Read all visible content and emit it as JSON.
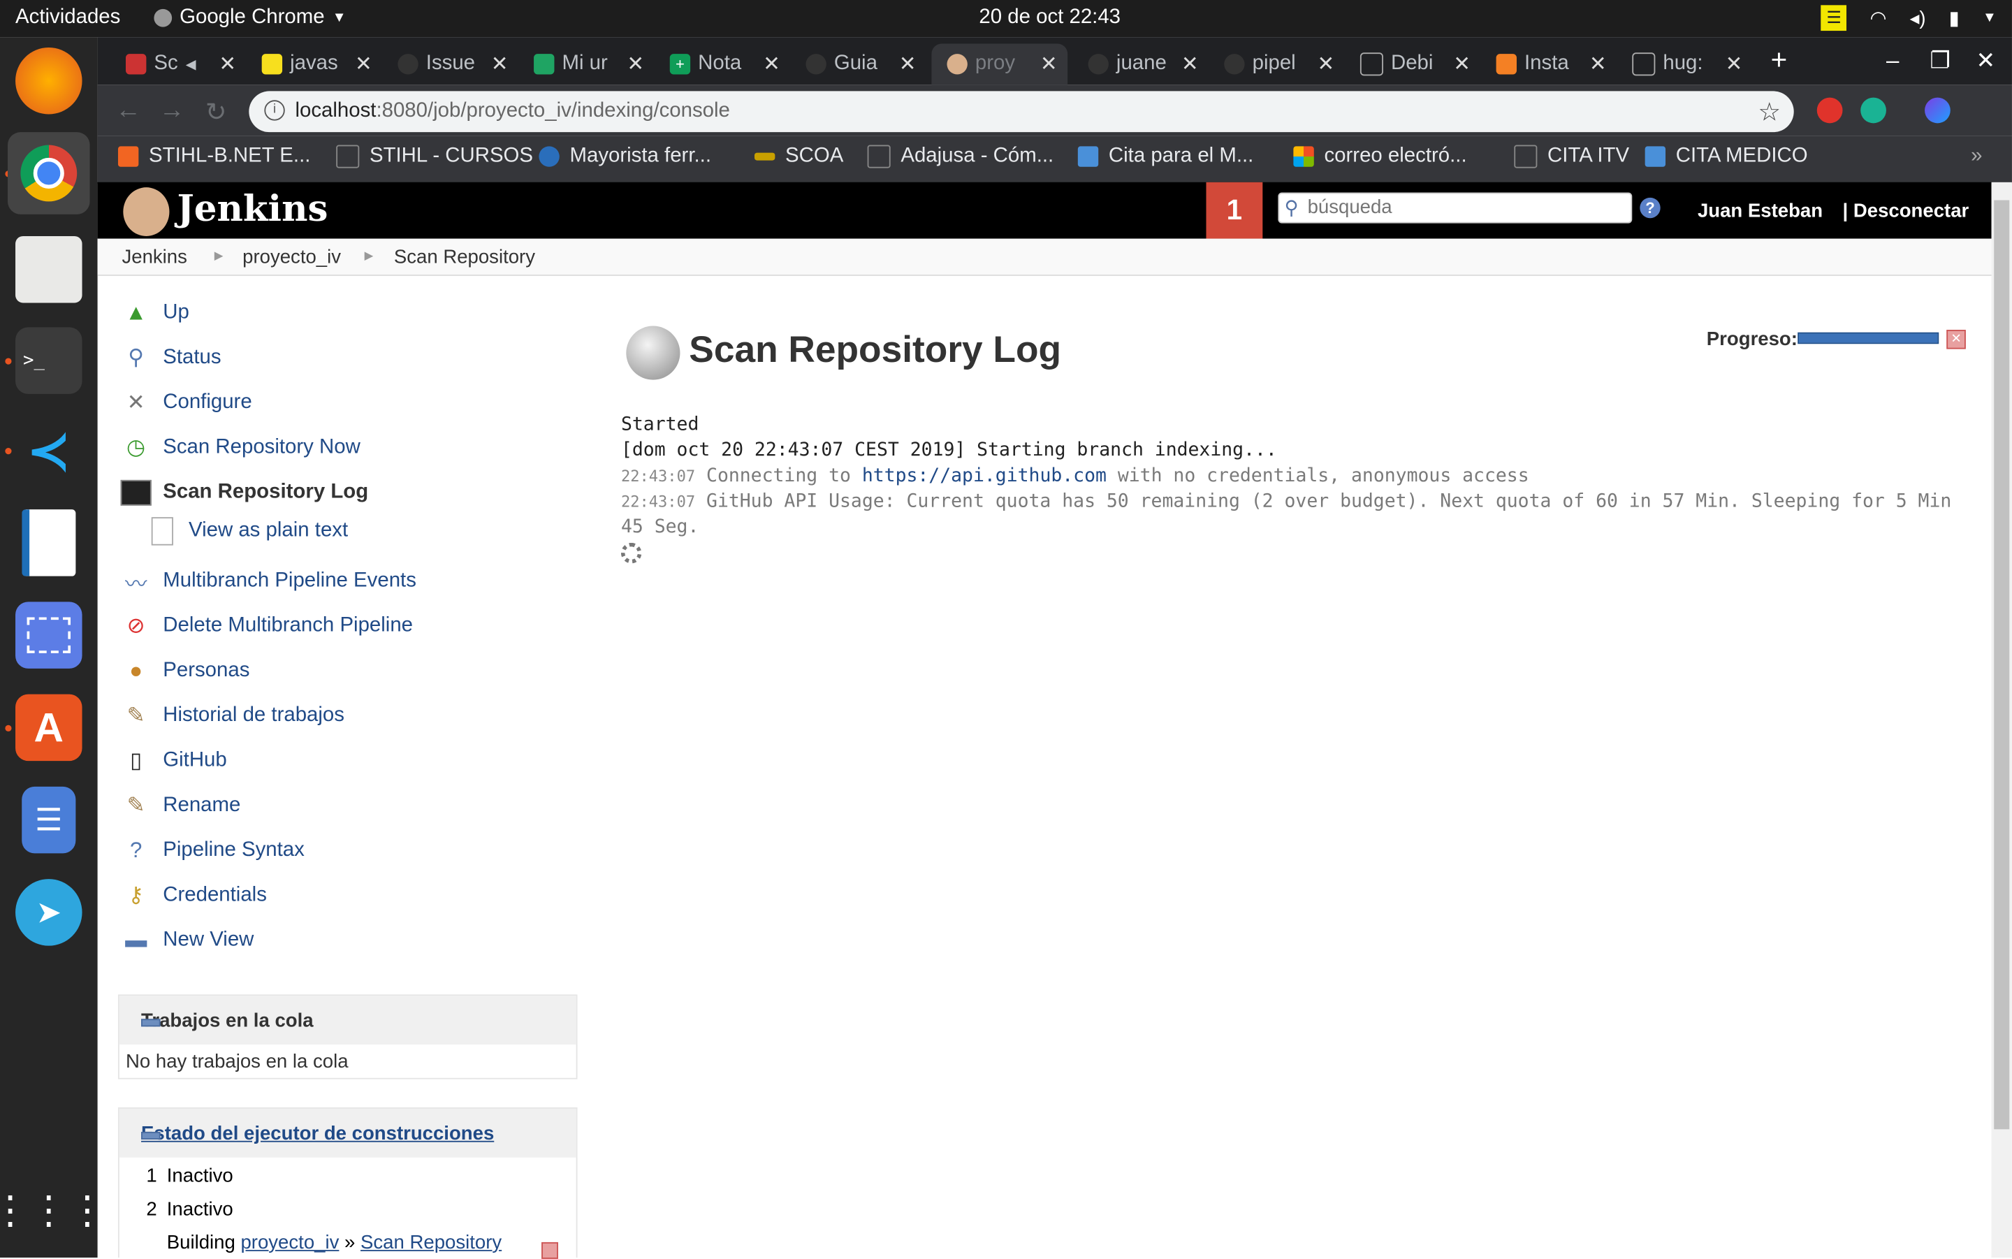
{
  "topbar": {
    "activities": "Actividades",
    "app_name": "Google Chrome",
    "clock": "20 de oct  22:43"
  },
  "dock": {
    "items": [
      "firefox-icon",
      "chrome-icon",
      "files-icon",
      "terminal-icon",
      "vscode-icon",
      "writer-icon",
      "screenshot-icon",
      "software-icon",
      "tasks-icon",
      "telegram-icon",
      "apps-grid-icon"
    ]
  },
  "tabs": [
    {
      "label": "Sc",
      "fav": "#c33"
    },
    {
      "label": "javas",
      "fav": "#f7df1e"
    },
    {
      "label": "Issue",
      "fav": "#333"
    },
    {
      "label": "Mi ur",
      "fav": "#1fa463"
    },
    {
      "label": "Nota",
      "fav": "#0f9d58"
    },
    {
      "label": "Guia",
      "fav": "#333"
    },
    {
      "label": "proy",
      "fav": "#d9b08c"
    },
    {
      "label": "juane",
      "fav": "#333"
    },
    {
      "label": "pipel",
      "fav": "#333"
    },
    {
      "label": "Debi",
      "fav": "#777"
    },
    {
      "label": "Insta",
      "fav": "#f48024"
    },
    {
      "label": "hug:",
      "fav": "#777"
    }
  ],
  "address": {
    "host": "localhost",
    "path": ":8080/job/proyecto_iv/indexing/console"
  },
  "bookmarks": [
    {
      "label": "STIHL-B.NET E...",
      "color": "#f26522"
    },
    {
      "label": "STIHL - CURSOS",
      "color": "#888"
    },
    {
      "label": "Mayorista ferr...",
      "color": "#2a6ebb"
    },
    {
      "label": "SCOA",
      "color": "#c8a000"
    },
    {
      "label": "Adajusa - Cóm...",
      "color": "#888"
    },
    {
      "label": "Cita para el M...",
      "color": "#4a90d9"
    },
    {
      "label": "correo electró...",
      "color": "#f25022"
    },
    {
      "label": "CITA ITV",
      "color": "#888"
    },
    {
      "label": "CITA MEDICO",
      "color": "#4a90d9"
    }
  ],
  "jenkins": {
    "brand": "Jenkins",
    "notifications": "1",
    "search_placeholder": "búsqueda",
    "user": "Juan Esteban",
    "logout": "| Desconectar",
    "breadcrumbs": [
      "Jenkins",
      "proyecto_iv",
      "Scan Repository"
    ],
    "tasks": [
      {
        "label": "Up",
        "icon": "up-arrow-icon"
      },
      {
        "label": "Status",
        "icon": "magnifier-icon"
      },
      {
        "label": "Configure",
        "icon": "tools-icon"
      },
      {
        "label": "Scan Repository Now",
        "icon": "clock-icon"
      },
      {
        "label": "Scan Repository Log",
        "icon": "terminal-icon"
      },
      {
        "label": "View as plain text",
        "icon": "document-icon"
      },
      {
        "label": "Multibranch Pipeline Events",
        "icon": "monitor-icon"
      },
      {
        "label": "Delete Multibranch Pipeline",
        "icon": "no-entry-icon"
      },
      {
        "label": "Personas",
        "icon": "people-icon"
      },
      {
        "label": "Historial de trabajos",
        "icon": "notepad-icon"
      },
      {
        "label": "GitHub",
        "icon": "github-icon"
      },
      {
        "label": "Rename",
        "icon": "notepad-icon"
      },
      {
        "label": "Pipeline Syntax",
        "icon": "help-icon"
      },
      {
        "label": "Credentials",
        "icon": "keys-icon"
      },
      {
        "label": "New View",
        "icon": "folder-icon"
      }
    ],
    "queue": {
      "title": "Trabajos en la cola",
      "empty": "No hay trabajos en la cola"
    },
    "executors": {
      "title": "Estado del ejecutor de construcciones",
      "rows": [
        "1",
        "Inactivo",
        "2",
        "Inactivo"
      ],
      "building_prefix": "Building",
      "building_job": "proyecto_iv",
      "sep": "»",
      "building_task": "Scan Repository"
    },
    "page_title": "Scan Repository Log",
    "progress_label": "Progreso:",
    "progress": 1.0,
    "log": {
      "line1": "Started",
      "line2": "[dom oct 20 22:43:07 CEST 2019] Starting branch indexing...",
      "ts1": "22:43:07",
      "line3a": " Connecting to ",
      "line3link": "https://api.github.com",
      "line3b": " with no credentials, anonymous access",
      "ts2": "22:43:07",
      "line4": " GitHub API Usage: Current quota has 50 remaining (2 over budget). Next quota of 60 in 57 Min. Sleeping for 5 Min 45 Seg."
    }
  }
}
